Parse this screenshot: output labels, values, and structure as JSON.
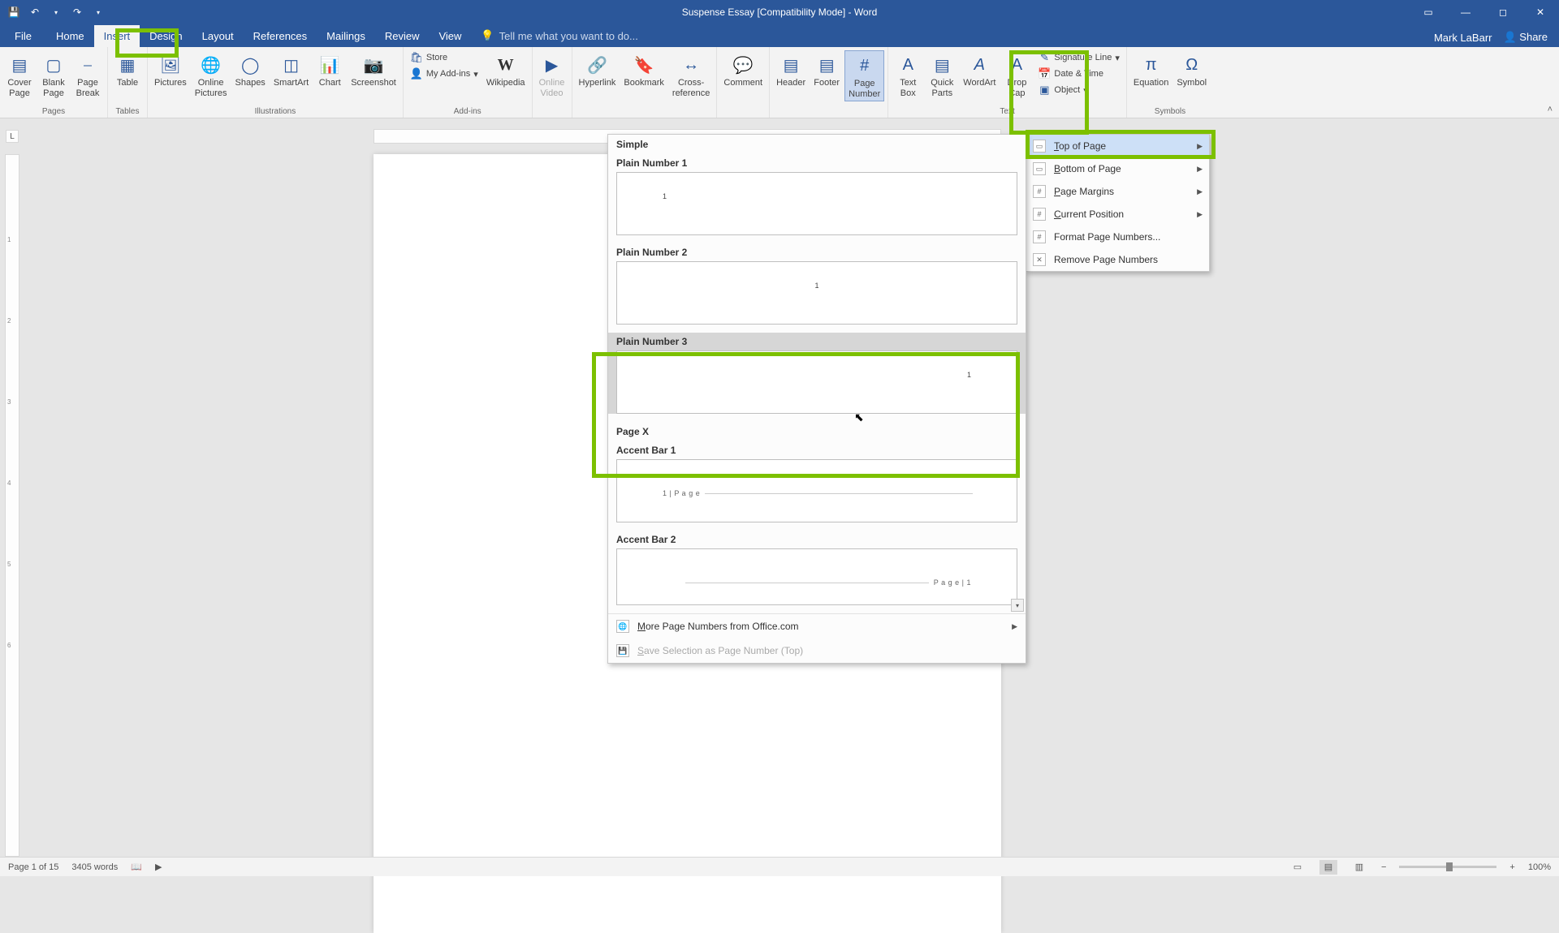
{
  "titlebar": {
    "title": "Suspense Essay [Compatibility Mode] - Word"
  },
  "tabs": {
    "file": "File",
    "home": "Home",
    "insert": "Insert",
    "design": "Design",
    "layout": "Layout",
    "references": "References",
    "mailings": "Mailings",
    "review": "Review",
    "view": "View",
    "tell_me": "Tell me what you want to do...",
    "user": "Mark LaBarr",
    "share": "Share"
  },
  "ribbon": {
    "groups": {
      "pages": "Pages",
      "tables": "Tables",
      "illustrations": "Illustrations",
      "addins": "Add-ins",
      "links": "",
      "comments": "",
      "header_footer": "",
      "text": "Text",
      "symbols": "Symbols"
    },
    "cover_page": "Cover\nPage",
    "blank_page": "Blank\nPage",
    "page_break": "Page\nBreak",
    "table": "Table",
    "pictures": "Pictures",
    "online_pictures": "Online\nPictures",
    "shapes": "Shapes",
    "smartart": "SmartArt",
    "chart": "Chart",
    "screenshot": "Screenshot",
    "store": "Store",
    "my_addins": "My Add-ins",
    "wikipedia": "Wikipedia",
    "online_video": "Online\nVideo",
    "hyperlink": "Hyperlink",
    "bookmark": "Bookmark",
    "cross_reference": "Cross-\nreference",
    "comment": "Comment",
    "header": "Header",
    "footer": "Footer",
    "page_number": "Page\nNumber",
    "text_box": "Text\nBox",
    "quick_parts": "Quick\nParts",
    "wordart": "WordArt",
    "drop_cap": "Drop\nCap",
    "signature_line": "Signature Line",
    "date_time": "Date & Time",
    "object": "Object",
    "equation": "Equation",
    "symbol": "Symbol"
  },
  "page_number_menu": {
    "top_of_page": "Top of Page",
    "bottom_of_page": "Bottom of Page",
    "page_margins": "Page Margins",
    "current_position": "Current Position",
    "format_page_numbers": "Format Page Numbers...",
    "remove_page_numbers": "Remove Page Numbers"
  },
  "gallery": {
    "category_simple": "Simple",
    "plain_number_1": "Plain Number 1",
    "plain_number_2": "Plain Number 2",
    "plain_number_3": "Plain Number 3",
    "category_pagex": "Page X",
    "accent_bar_1": "Accent Bar 1",
    "accent_bar_2": "Accent Bar 2",
    "sample_num": "1",
    "ab1_text": "1 | P a g e",
    "ab2_text": "P a g e  | 1",
    "more_from_office": "More Page Numbers from Office.com",
    "save_selection": "Save Selection as Page Number (Top)"
  },
  "statusbar": {
    "page": "Page 1 of 15",
    "words": "3405 words",
    "zoom": "100%"
  }
}
